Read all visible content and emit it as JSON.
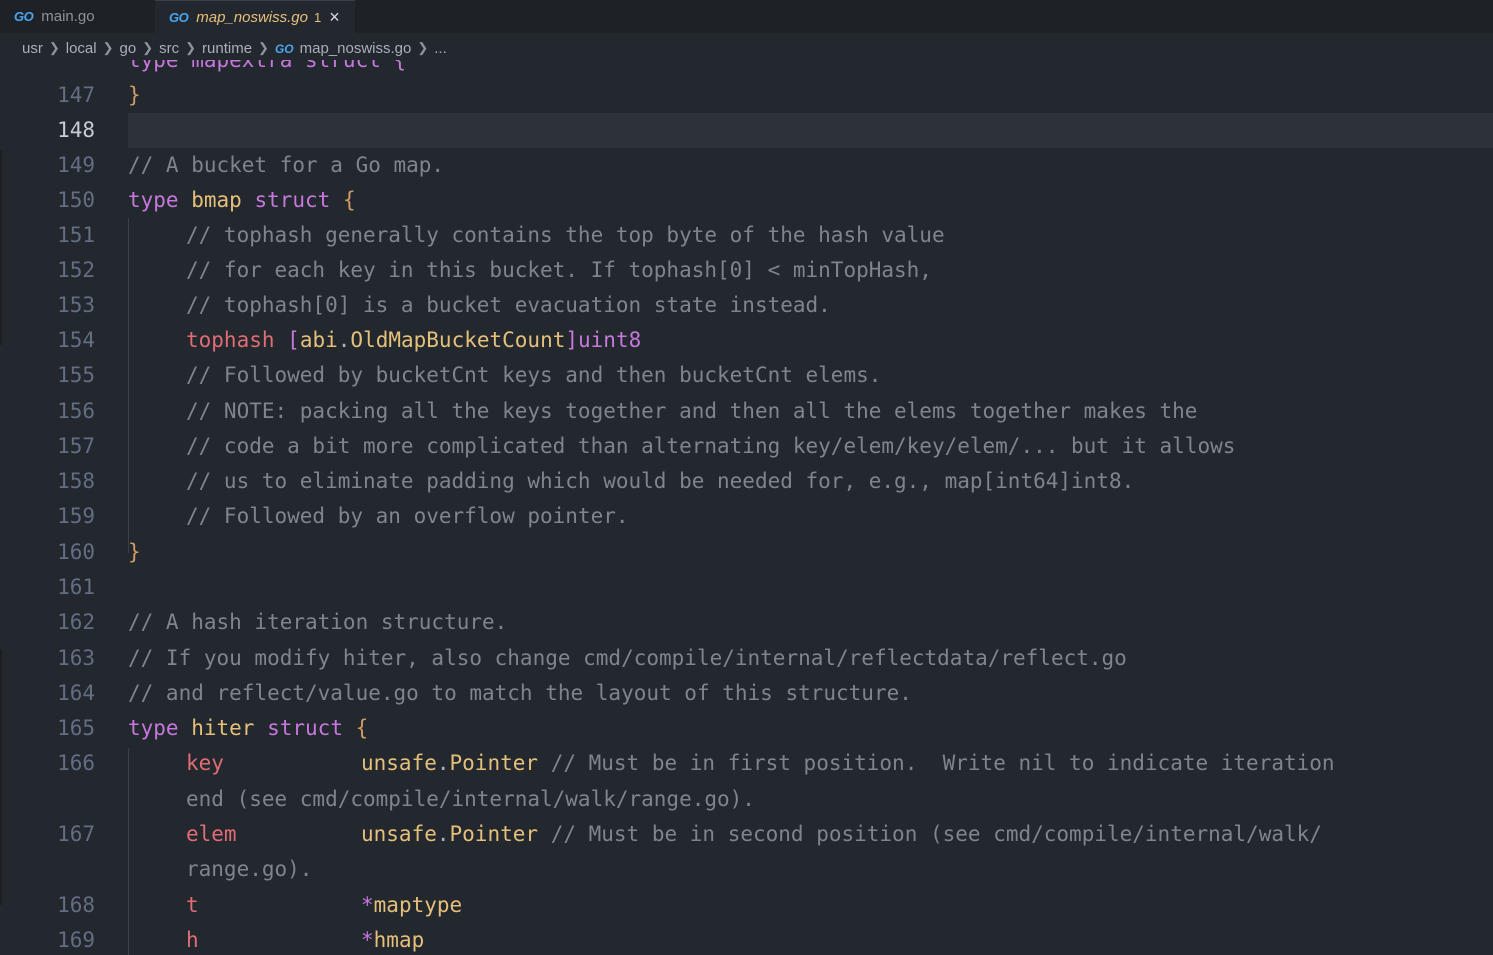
{
  "tabs": [
    {
      "icon": "GO",
      "label": "main.go"
    },
    {
      "icon": "GO",
      "label": "map_noswiss.go",
      "badge": "1",
      "close": "×"
    }
  ],
  "breadcrumb": {
    "items": [
      "usr",
      "local",
      "go",
      "src",
      "runtime"
    ],
    "file_icon": "GO",
    "file": "map_noswiss.go",
    "tail": "..."
  },
  "editor": {
    "top_partial": "type mapextra struct {",
    "lines": [
      {
        "n": "147",
        "t": "}"
      },
      {
        "n": "148",
        "t": ""
      },
      {
        "n": "149",
        "t": "// A bucket for a Go map."
      },
      {
        "n": "150",
        "kw1": "type",
        "name": "bmap",
        "kw2": "struct",
        "brace": "{"
      },
      {
        "n": "151",
        "t": "// tophash generally contains the top byte of the hash value"
      },
      {
        "n": "152",
        "t": "// for each key in this bucket. If tophash[0] < minTopHash,"
      },
      {
        "n": "153",
        "t": "// tophash[0] is a bucket evacuation state instead."
      },
      {
        "n": "154",
        "field": "tophash",
        "lb": "[",
        "pkg": "abi",
        "dot": ".",
        "const": "OldMapBucketCount",
        "rb": "]",
        "type": "uint8"
      },
      {
        "n": "155",
        "t": "// Followed by bucketCnt keys and then bucketCnt elems."
      },
      {
        "n": "156",
        "t": "// NOTE: packing all the keys together and then all the elems together makes the"
      },
      {
        "n": "157",
        "t": "// code a bit more complicated than alternating key/elem/key/elem/... but it allows"
      },
      {
        "n": "158",
        "t": "// us to eliminate padding which would be needed for, e.g., map[int64]int8."
      },
      {
        "n": "159",
        "t": "// Followed by an overflow pointer."
      },
      {
        "n": "160",
        "t": "}"
      },
      {
        "n": "161",
        "t": ""
      },
      {
        "n": "162",
        "t": "// A hash iteration structure."
      },
      {
        "n": "163",
        "t": "// If you modify hiter, also change cmd/compile/internal/reflectdata/reflect.go"
      },
      {
        "n": "164",
        "t": "// and reflect/value.go to match the layout of this structure."
      },
      {
        "n": "165",
        "kw1": "type",
        "name": "hiter",
        "kw2": "struct",
        "brace": "{"
      },
      {
        "n": "166",
        "field": "key",
        "pkg": "unsafe",
        "dot": ".",
        "type": "Pointer",
        "comment": "// Must be in first position.  Write nil to indicate iteration",
        "wrap": "end (see cmd/compile/internal/walk/range.go)."
      },
      {
        "n": "167",
        "field": "elem",
        "pkg": "unsafe",
        "dot": ".",
        "type": "Pointer",
        "comment": "// Must be in second position (see cmd/compile/internal/walk/",
        "wrap": "range.go)."
      },
      {
        "n": "168",
        "field": "t",
        "star": "*",
        "type": "maptype"
      },
      {
        "n": "169",
        "field": "h",
        "star": "*",
        "type": "hmap"
      }
    ]
  },
  "colors": {
    "background": "#23272e",
    "keyword": "#c678dd",
    "type": "#e5c07b",
    "comment": "#7f848e",
    "field": "#e06c75",
    "go_icon": "#4aa5f0"
  }
}
